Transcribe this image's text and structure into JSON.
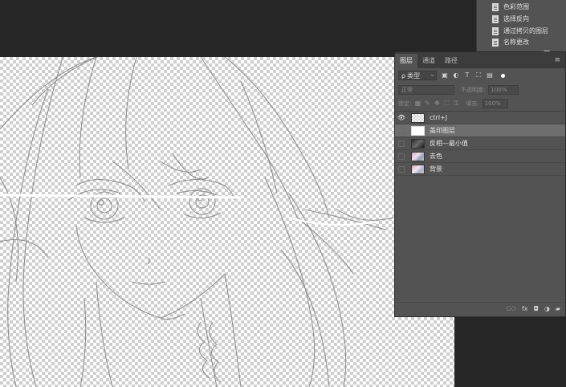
{
  "history": {
    "items": [
      {
        "label": "色彩范围"
      },
      {
        "label": "选择反向"
      },
      {
        "label": "通过拷贝的图层"
      },
      {
        "label": "名称更改"
      }
    ],
    "bottom_icons": [
      "snapshot-icon",
      "camera-icon",
      "trash-icon"
    ]
  },
  "layers_panel": {
    "tabs": [
      {
        "label": "图层"
      },
      {
        "label": "通道"
      },
      {
        "label": "路径"
      }
    ],
    "filter": {
      "label": "类型",
      "prefix": "ρ"
    },
    "blend_mode": "正常",
    "opacity_label": "不透明度:",
    "opacity_value": "100%",
    "lock_label": "锁定:",
    "fill_label": "填充:",
    "fill_value": "100%",
    "layers": [
      {
        "name": "ctrl+J",
        "visible": true,
        "selected": false
      },
      {
        "name": "盖印图层",
        "visible": false,
        "selected": true
      },
      {
        "name": "反相—最小值",
        "visible": false,
        "selected": false
      },
      {
        "name": "去色",
        "visible": false,
        "selected": false
      },
      {
        "name": "背景",
        "visible": false,
        "selected": false
      }
    ],
    "bottom_labels": {
      "link": "GO",
      "fx": "fx"
    }
  },
  "colors": {
    "workspace_bg": "#262626",
    "panel_bg": "#535353",
    "selected_layer": "#6e6e6e"
  }
}
